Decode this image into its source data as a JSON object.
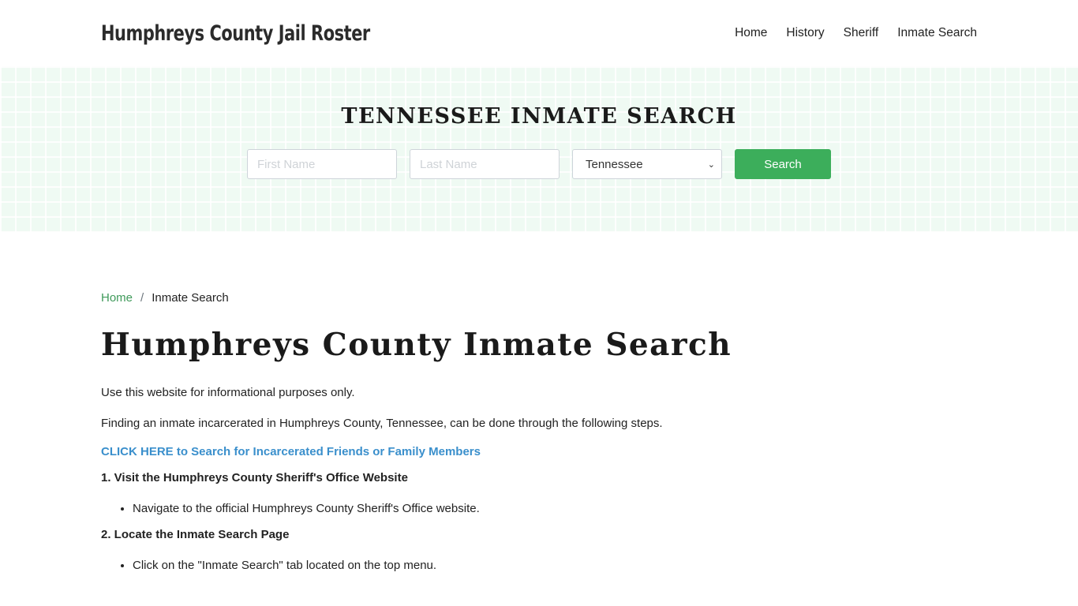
{
  "header": {
    "brand": "Humphreys County Jail Roster",
    "nav": [
      {
        "label": "Home"
      },
      {
        "label": "History"
      },
      {
        "label": "Sheriff"
      },
      {
        "label": "Inmate Search"
      }
    ]
  },
  "hero": {
    "title": "TENNESSEE INMATE SEARCH",
    "first_name_placeholder": "First Name",
    "first_name_value": "",
    "last_name_placeholder": "Last Name",
    "last_name_value": "",
    "state_selected": "Tennessee",
    "search_label": "Search"
  },
  "breadcrumb": {
    "home": "Home",
    "separator": "/",
    "current": "Inmate Search"
  },
  "content": {
    "title": "Humphreys County Inmate Search",
    "intro": "Use this website for informational purposes only.",
    "lead": "Finding an inmate incarcerated in Humphreys County, Tennessee, can be done through the following steps.",
    "cta": "CLICK HERE to Search for Incarcerated Friends or Family Members",
    "steps": [
      {
        "title": "1. Visit the Humphreys County Sheriff's Office Website",
        "bullets": [
          "Navigate to the official Humphreys County Sheriff's Office website."
        ]
      },
      {
        "title": "2. Locate the Inmate Search Page",
        "bullets": [
          "Click on the \"Inmate Search\" tab located on the top menu."
        ]
      }
    ]
  },
  "colors": {
    "accent_green": "#3cae5b",
    "link_blue": "#3a8fcc",
    "hero_bg": "#effaf3"
  }
}
